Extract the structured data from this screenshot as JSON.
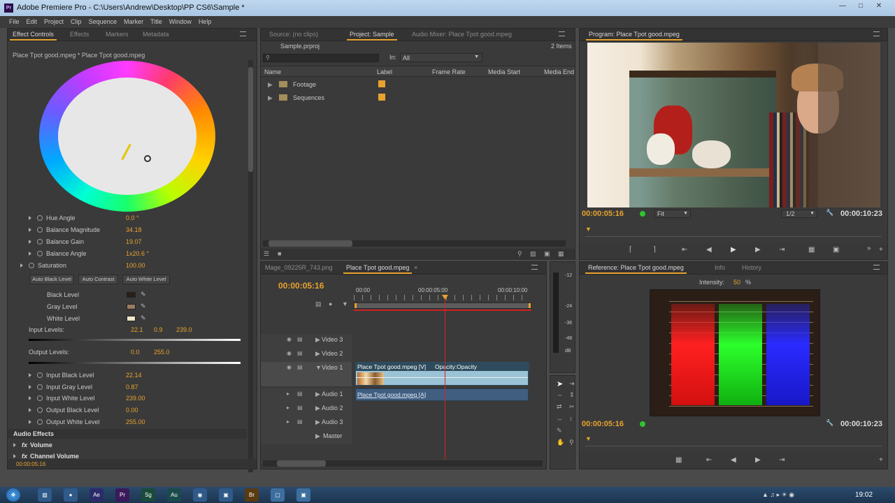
{
  "window": {
    "title": "Adobe Premiere Pro - C:\\Users\\Andrew\\Desktop\\PP CS6\\Sample *"
  },
  "menu": [
    "File",
    "Edit",
    "Project",
    "Clip",
    "Sequence",
    "Marker",
    "Title",
    "Window",
    "Help"
  ],
  "left_tabs": {
    "effect_controls": "Effect Controls",
    "effects": "Effects",
    "markers": "Markers",
    "metadata": "Metadata"
  },
  "effect": {
    "clip_path": "Place Tpot good.mpeg * Place Tpot good.mpeg",
    "params": [
      {
        "label": "Hue Angle",
        "value": "0.0 °"
      },
      {
        "label": "Balance Magnitude",
        "value": "34.18"
      },
      {
        "label": "Balance Gain",
        "value": "19.07"
      },
      {
        "label": "Balance Angle",
        "value": "1x20.6 °"
      }
    ],
    "saturation": {
      "label": "Saturation",
      "value": "100.00"
    },
    "buttons": {
      "auto_black": "Auto Black Level",
      "auto_contrast": "Auto Contrast",
      "auto_white": "Auto White Level"
    },
    "levels": [
      {
        "label": "Black Level",
        "color": "#2a1e18"
      },
      {
        "label": "Gray Level",
        "color": "#9a7a60"
      },
      {
        "label": "White Level",
        "color": "#f2e6c8"
      }
    ],
    "input_levels": {
      "label": "Input Levels:",
      "v1": "22.1",
      "v2": "0.9",
      "v3": "239.0"
    },
    "output_levels": {
      "label": "Output Levels:",
      "v1": "0.0",
      "v2": "255.0"
    },
    "level_params": [
      {
        "label": "Input Black Level",
        "value": "22.14"
      },
      {
        "label": "Input Gray Level",
        "value": "0.87"
      },
      {
        "label": "Input White Level",
        "value": "239.00"
      },
      {
        "label": "Output Black Level",
        "value": "0.00"
      },
      {
        "label": "Output White Level",
        "value": "255.00"
      }
    ],
    "audio_effects": "Audio Effects",
    "volume": "Volume",
    "channel_volume": "Channel Volume",
    "timecode": "00:00:05:16"
  },
  "project": {
    "tabs": {
      "source": "Source: (no clips)",
      "project": "Project: Sample",
      "audio_mixer": "Audio Mixer: Place Tpot good.mpeg"
    },
    "file": "Sample.prproj",
    "items_count": "2 Items",
    "in_label": "In:",
    "in_value": "All",
    "columns": [
      "Name",
      "Label",
      "Frame Rate",
      "Media Start",
      "Media End"
    ],
    "rows": [
      {
        "name": "Footage",
        "color": "#e8a32e"
      },
      {
        "name": "Sequences",
        "color": "#e8a32e"
      }
    ]
  },
  "program": {
    "tab": "Program: Place Tpot good.mpeg",
    "timecode": "00:00:05:16",
    "fit": "Fit",
    "resolution": "1/2",
    "duration": "00:00:10:23"
  },
  "timeline": {
    "tabs": [
      "Mage_09225R_743.png",
      "Place Tpot good.mpeg"
    ],
    "timecode": "00:00:05:16",
    "ruler": [
      "00:00",
      "00:00:05:00",
      "00:00:10:00"
    ],
    "tracks": [
      "Video 3",
      "Video 2",
      "Video 1",
      "Audio 1",
      "Audio 2",
      "Audio 3",
      "Master"
    ],
    "video_clip": "Place Tpot good.mpeg [V]",
    "opacity": "Opacity:Opacity",
    "audio_clip": "Place Tpot good.mpeg [A]"
  },
  "meter": [
    "-12",
    "-24",
    "-36",
    "-48",
    "dB"
  ],
  "reference": {
    "tabs": {
      "reference": "Reference: Place Tpot good.mpeg",
      "info": "Info",
      "history": "History"
    },
    "intensity_label": "Intensity:",
    "intensity_value": "50",
    "intensity_unit": "%",
    "timecode": "00:00:05:16",
    "duration": "00:00:10:23"
  },
  "taskbar": {
    "clock": "19:02"
  }
}
